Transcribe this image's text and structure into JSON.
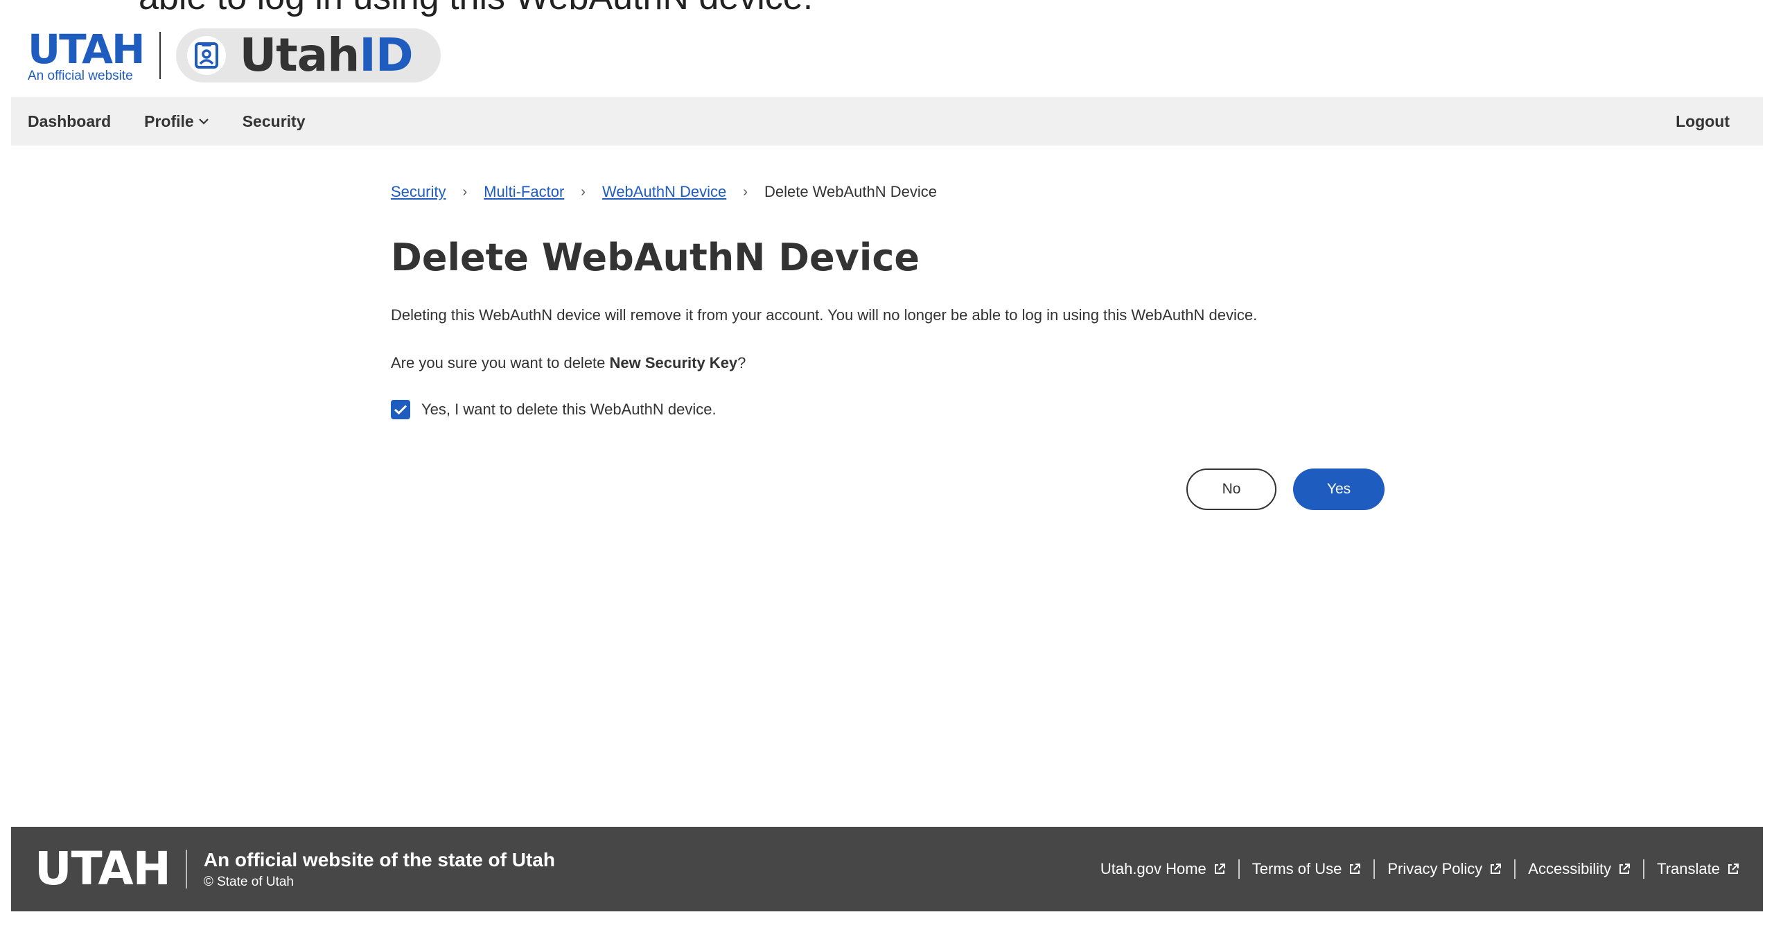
{
  "overlay": {
    "caption": "able to log in using this WebAuthN device."
  },
  "header": {
    "utah_logo": "UTAH",
    "utah_sub": "An official website",
    "app_name_prefix": "Utah",
    "app_name_suffix": "ID"
  },
  "nav": {
    "dashboard": "Dashboard",
    "profile": "Profile",
    "security": "Security",
    "logout": "Logout"
  },
  "breadcrumb": {
    "items": [
      "Security",
      "Multi-Factor",
      "WebAuthN Device"
    ],
    "current": "Delete WebAuthN Device",
    "separator": "›"
  },
  "main": {
    "title": "Delete WebAuthN Device",
    "description": "Deleting this WebAuthN device will remove it from your account. You will no longer be able to log in using this WebAuthN device.",
    "question_prefix": "Are you sure you want to delete ",
    "device_name": "New Security Key",
    "question_suffix": "?",
    "confirm_label": "Yes, I want to delete this WebAuthN device.",
    "confirm_checked": true,
    "no_label": "No",
    "yes_label": "Yes"
  },
  "footer": {
    "logo": "UTAH",
    "official": "An official website of the state of Utah",
    "copyright": "© State of Utah",
    "links": [
      "Utah.gov Home",
      "Terms of Use",
      "Privacy Policy",
      "Accessibility",
      "Translate"
    ]
  },
  "colors": {
    "brand_blue": "#1f5cbf",
    "nav_bg": "#f0f0f0",
    "footer_bg": "#474747",
    "text": "#333333"
  },
  "icons": {
    "profile_chevron": "chevron-down-icon",
    "id_badge": "id-card-icon",
    "checkbox": "checkmark-icon",
    "external_link": "external-link-icon"
  }
}
